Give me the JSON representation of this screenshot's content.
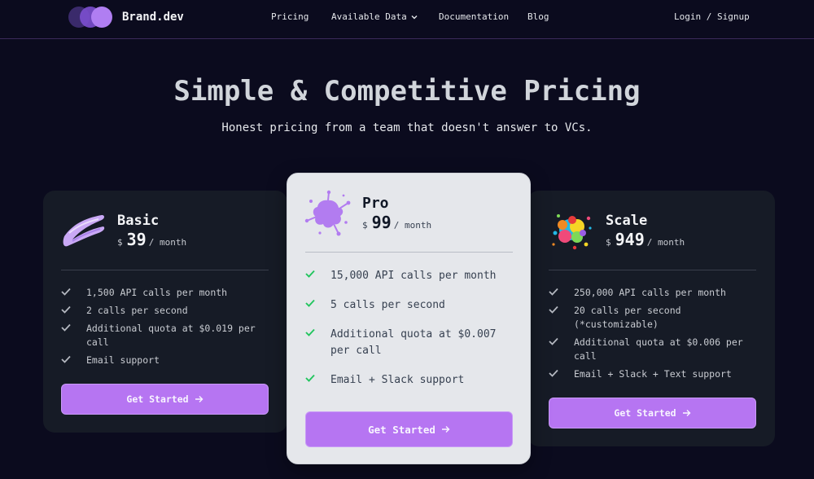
{
  "nav": {
    "brand": "Brand.dev",
    "links": [
      "Pricing",
      "Available Data",
      "Documentation",
      "Blog"
    ],
    "auth": "Login / Signup"
  },
  "hero": {
    "title": "Simple & Competitive Pricing",
    "subtitle": "Honest pricing from a team that doesn't answer to VCs."
  },
  "plans": [
    {
      "name": "Basic",
      "currency": "$",
      "price": "39",
      "period": "/ month",
      "features": [
        "1,500 API calls per month",
        "2 calls per second",
        "Additional quota at $0.019 per call",
        "Email support"
      ],
      "cta": "Get Started",
      "icon": "brush-stroke-icon"
    },
    {
      "name": "Pro",
      "currency": "$",
      "price": "99",
      "period": "/ month",
      "features": [
        "15,000 API calls per month",
        "5 calls per second",
        "Additional quota at $0.007 per call",
        "Email + Slack support"
      ],
      "cta": "Get Started",
      "icon": "paint-splat-icon"
    },
    {
      "name": "Scale",
      "currency": "$",
      "price": "949",
      "period": "/ month",
      "features": [
        "250,000 API calls per month",
        "20 calls per second (*customizable)",
        "Additional quota at $0.006 per call",
        "Email + Slack + Text support"
      ],
      "cta": "Get Started",
      "icon": "rainbow-splat-icon"
    }
  ],
  "colors": {
    "background": "#0b0b1e",
    "accent": "#b675f2",
    "check_dark": "#b4b8c0",
    "check_light": "#22c55e"
  }
}
